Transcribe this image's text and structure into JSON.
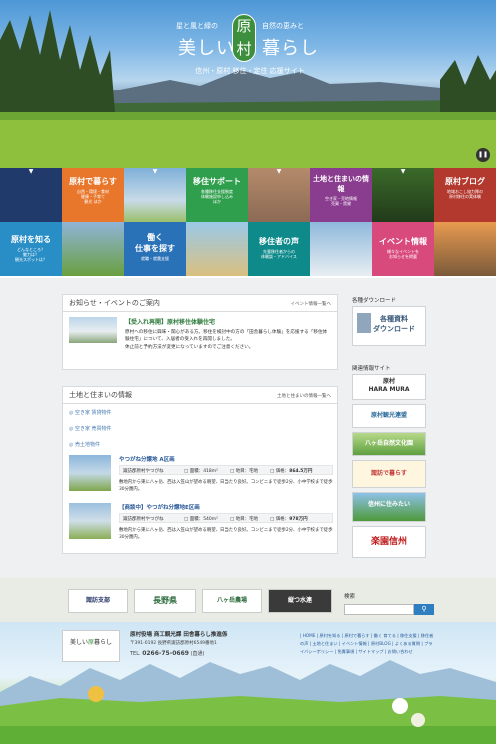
{
  "hero": {
    "tagline_left": "星と風と緑の",
    "tagline_right": "自然の恵みと",
    "title_pre": "美しい",
    "title_kanji_1": "原",
    "title_kanji_2": "村",
    "title_post": "暮らし",
    "subtitle": "信州・原村 移住・定住 応援サイト",
    "pause_icon": "pause-icon"
  },
  "nav": {
    "tiles": [
      {
        "title": "原村で暮らす",
        "sub": "自然・環境・食材\n健康・子育て\n観光 ほか"
      },
      {
        "title": "移住サポート",
        "sub": "各種移住支援制度\n体験施設申し込み\nほか"
      },
      {
        "title": "土地と住まいの情報",
        "sub": "空き家・売地情報\n売買・賃貸"
      },
      {
        "title": "原村ブログ",
        "sub": "地域おこし協力隊の\n原村移住の実体験"
      },
      {
        "title": "原村を知る",
        "sub": "どんなところ？\n魅力は？\n観光スポットは？"
      },
      {
        "title": "働く\n仕事を探す",
        "sub": "就職・就農支援"
      },
      {
        "title": "移住者の声",
        "sub": "先輩移住者からの\n体験談・アドバイス"
      },
      {
        "title": "イベント情報",
        "sub": "様々なイベントを\nお知らせを掲載"
      }
    ]
  },
  "news": {
    "heading": "お知らせ・イベントのご案内",
    "more": "イベント情報一覧へ",
    "item_title": "【受入れ再開】原村移住体験住宅",
    "item_body": "原村への移住に興味・関心がある方。移住を検討中の方の「田舎暮らし体験」を応援する「移住体験住宅」について、入居者の受入れを再開しました。\n休止前と予約方法が変更になっていますのでご注意ください。"
  },
  "land": {
    "heading": "土地と住まいの情報",
    "more": "土地と住まいの情報一覧へ",
    "cat1": "空き家 賃貸物件",
    "cat2": "空き家 売買物件",
    "cat3": "売土地物件",
    "listings": [
      {
        "title": "やつがね分譲地 A区画",
        "loc": "諏訪郡原村やつがね",
        "area_label": "面積：",
        "area": "418m²",
        "land_label": "地目：宅地",
        "price_label": "価格：",
        "price": "864.5万円",
        "desc": "敷地内から東に八ヶ岳、西は入笠山が望める眺望、日当たり良好。コンビニまで徒歩2分、小中学校まで徒歩30分圏内。"
      },
      {
        "title": "【商談中】やつがね分譲地E区画",
        "loc": "諏訪郡原村やつがね",
        "area_label": "面積：",
        "area": "540m²",
        "land_label": "地目：宅地",
        "price_label": "価格：",
        "price": "978万円",
        "desc": "敷地内から東に八ヶ岳、西は入笠山が望める眺望、日当たり良好。コンビニまで徒歩2分、小中学校まで徒歩30分圏内。"
      }
    ]
  },
  "sidebar": {
    "download_title": "各種ダウンロード",
    "download_banner": "各種資料\nダウンロード",
    "links_title": "関連情報サイト",
    "banners": [
      "原村\nHARA MURA",
      "原村観光連盟",
      "八ヶ岳自然文化園",
      "諏訪で暮らす",
      "信州に住みたい",
      "楽園信州"
    ]
  },
  "footer": {
    "logos": [
      "諏訪支部",
      "長野県",
      "八ヶ岳農場",
      "縦つ水連"
    ],
    "search_label": "検索",
    "search_placeholder": "",
    "org": "原村役場 商工観光課 田舎暮らし推進係",
    "address": "〒391-0192 長野県諏訪郡原村6549番地1",
    "tel_label": "TEL.",
    "tel": "0266-75-0669",
    "tel_note": "(直通)",
    "links": "| HOME | 原村を知る | 原村で暮らす | 働く 育てる | 移住支援 | 移住者の声 | 土地と住まい | イベント情報 | 原村BLOG | よくある質問 | プライバシーポリシー | 免責事項 | サイトマップ | お問い合わせ"
  }
}
